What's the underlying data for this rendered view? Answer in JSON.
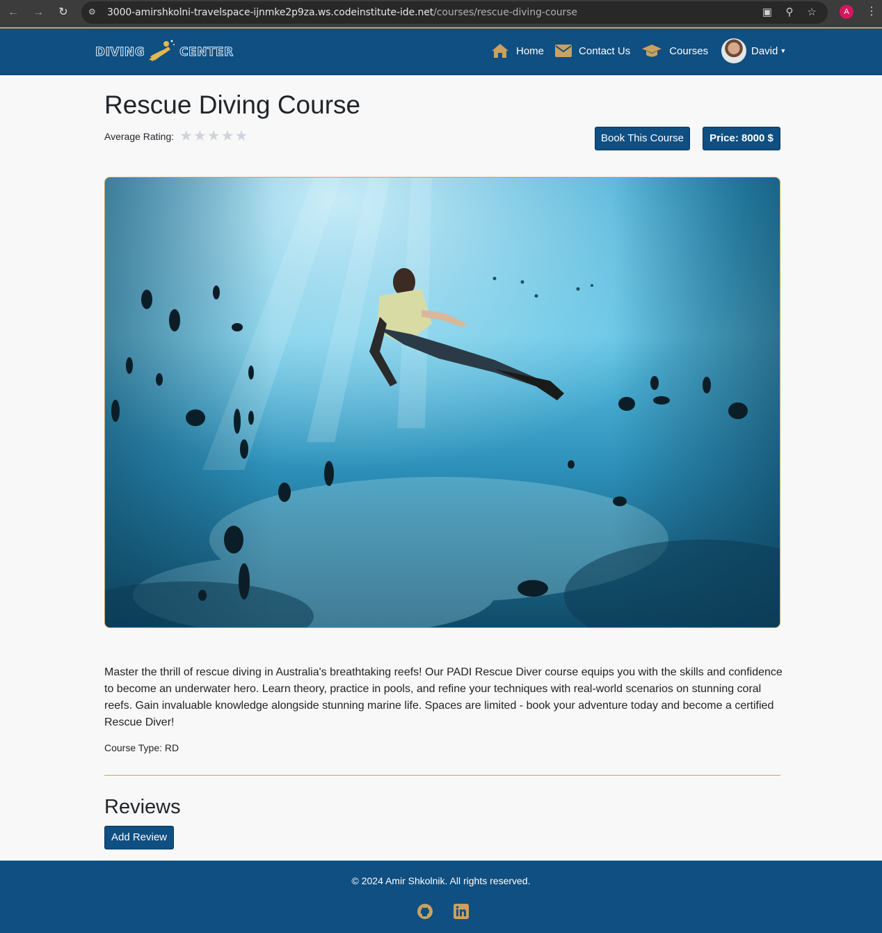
{
  "browser": {
    "url_host": "3000-amirshkolni-travelspace-ijnmke2p9za.ws.codeinstitute-ide.net",
    "url_path": "/courses/rescue-diving-course",
    "profile_initial": "A"
  },
  "navbar": {
    "logo_left": "DIVING",
    "logo_right": "CENTER",
    "links": [
      {
        "label": "Home",
        "icon": "home-icon"
      },
      {
        "label": "Contact Us",
        "icon": "envelope-icon"
      },
      {
        "label": "Courses",
        "icon": "graduation-cap-icon"
      }
    ],
    "user_name": "David"
  },
  "course": {
    "title": "Rescue Diving Course",
    "rating_label": "Average Rating:",
    "rating_stars": "★★★★★",
    "rating_value": 0,
    "book_label": "Book This Course",
    "price_label": "Price: 8000 $",
    "description": "Master the thrill of rescue diving in Australia's breathtaking reefs! Our PADI Rescue Diver course equips you with the skills and confidence to become an underwater hero. Learn theory, practice in pools, and refine your techniques with real-world scenarios on stunning coral reefs. Gain invaluable knowledge alongside stunning marine life. Spaces are limited - book your adventure today and become a certified Rescue Diver!",
    "course_type": "Course Type: RD"
  },
  "reviews": {
    "heading": "Reviews",
    "add_label": "Add Review"
  },
  "footer": {
    "copyright": "© 2024 Amir Shkolnik. All rights reserved.",
    "icons": [
      "github-icon",
      "linkedin-icon"
    ]
  },
  "colors": {
    "primary": "#0f4f82",
    "accent": "#c9a25f",
    "background": "#f8f8f8"
  }
}
